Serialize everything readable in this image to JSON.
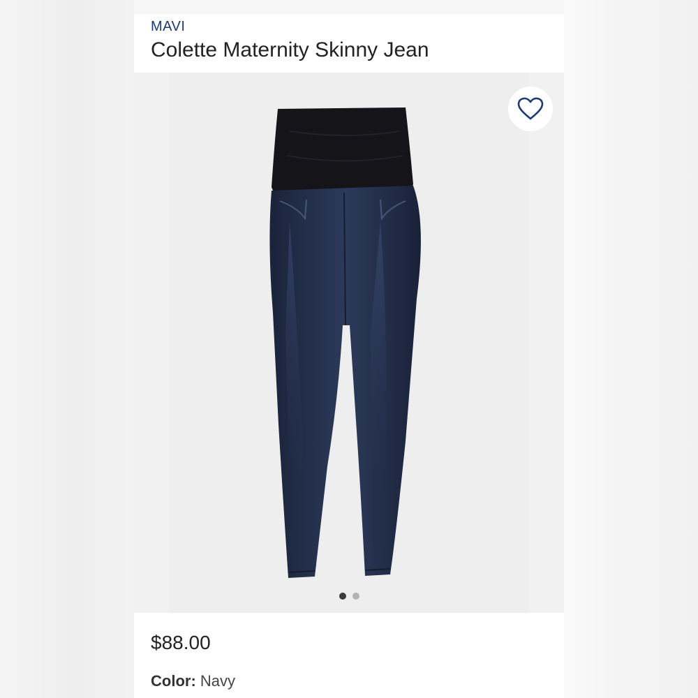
{
  "product": {
    "brand": "MAVI",
    "title": "Colette Maternity Skinny Jean",
    "price": "$88.00",
    "color_label": "Color:",
    "color_value": "Navy",
    "image_subject": "dark wash maternity skinny jeans with black over-belly panel"
  },
  "gallery": {
    "image_count": 2,
    "active_index": 0
  },
  "icons": {
    "favorite": "heart-outline-icon"
  },
  "colors": {
    "brand_text": "#1d3a73",
    "heart": "#1d3a73",
    "denim": "#1f2a44",
    "panel": "#151418"
  }
}
